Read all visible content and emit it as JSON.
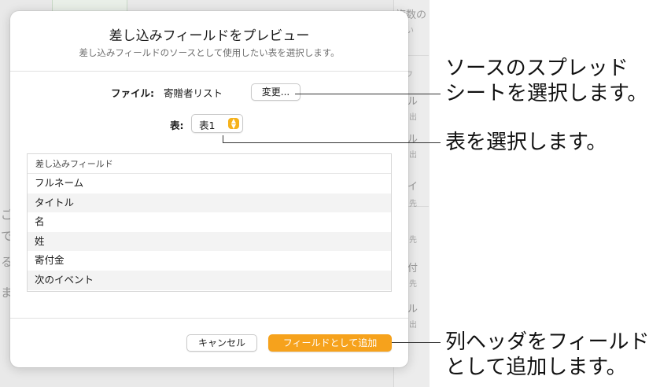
{
  "background": {
    "right_column_texts": [
      "複数の",
      "わい",
      "みフ",
      "ル",
      "出",
      "ル",
      "出",
      "イ",
      "先",
      "先",
      "付",
      "先",
      "ル",
      "出"
    ],
    "left_column_texts": [
      "ご",
      "で",
      "る",
      "ま"
    ]
  },
  "dialog": {
    "title": "差し込みフィールドをプレビュー",
    "subtitle": "差し込みフィールドのソースとして使用したい表を選択します。",
    "file_label": "ファイル:",
    "file_value": "寄贈者リスト",
    "change_button": "変更...",
    "table_label": "表:",
    "table_select_value": "表1",
    "fields_header": "差し込みフィールド",
    "fields": [
      "フルネーム",
      "タイトル",
      "名",
      "姓",
      "寄付金",
      "次のイベント"
    ],
    "cancel_button": "キャンセル",
    "add_button": "フィールドとして追加"
  },
  "callouts": {
    "source": [
      "ソースのスプレッド",
      "シートを選択します。"
    ],
    "table": [
      "表を選択します。"
    ],
    "headers": [
      "列ヘッダをフィールド",
      "として追加します。"
    ]
  },
  "colors": {
    "accent": "#f6a21c",
    "select_arrow": "#f6b21b"
  },
  "icons": {
    "select": "chevron-up-down-icon"
  }
}
